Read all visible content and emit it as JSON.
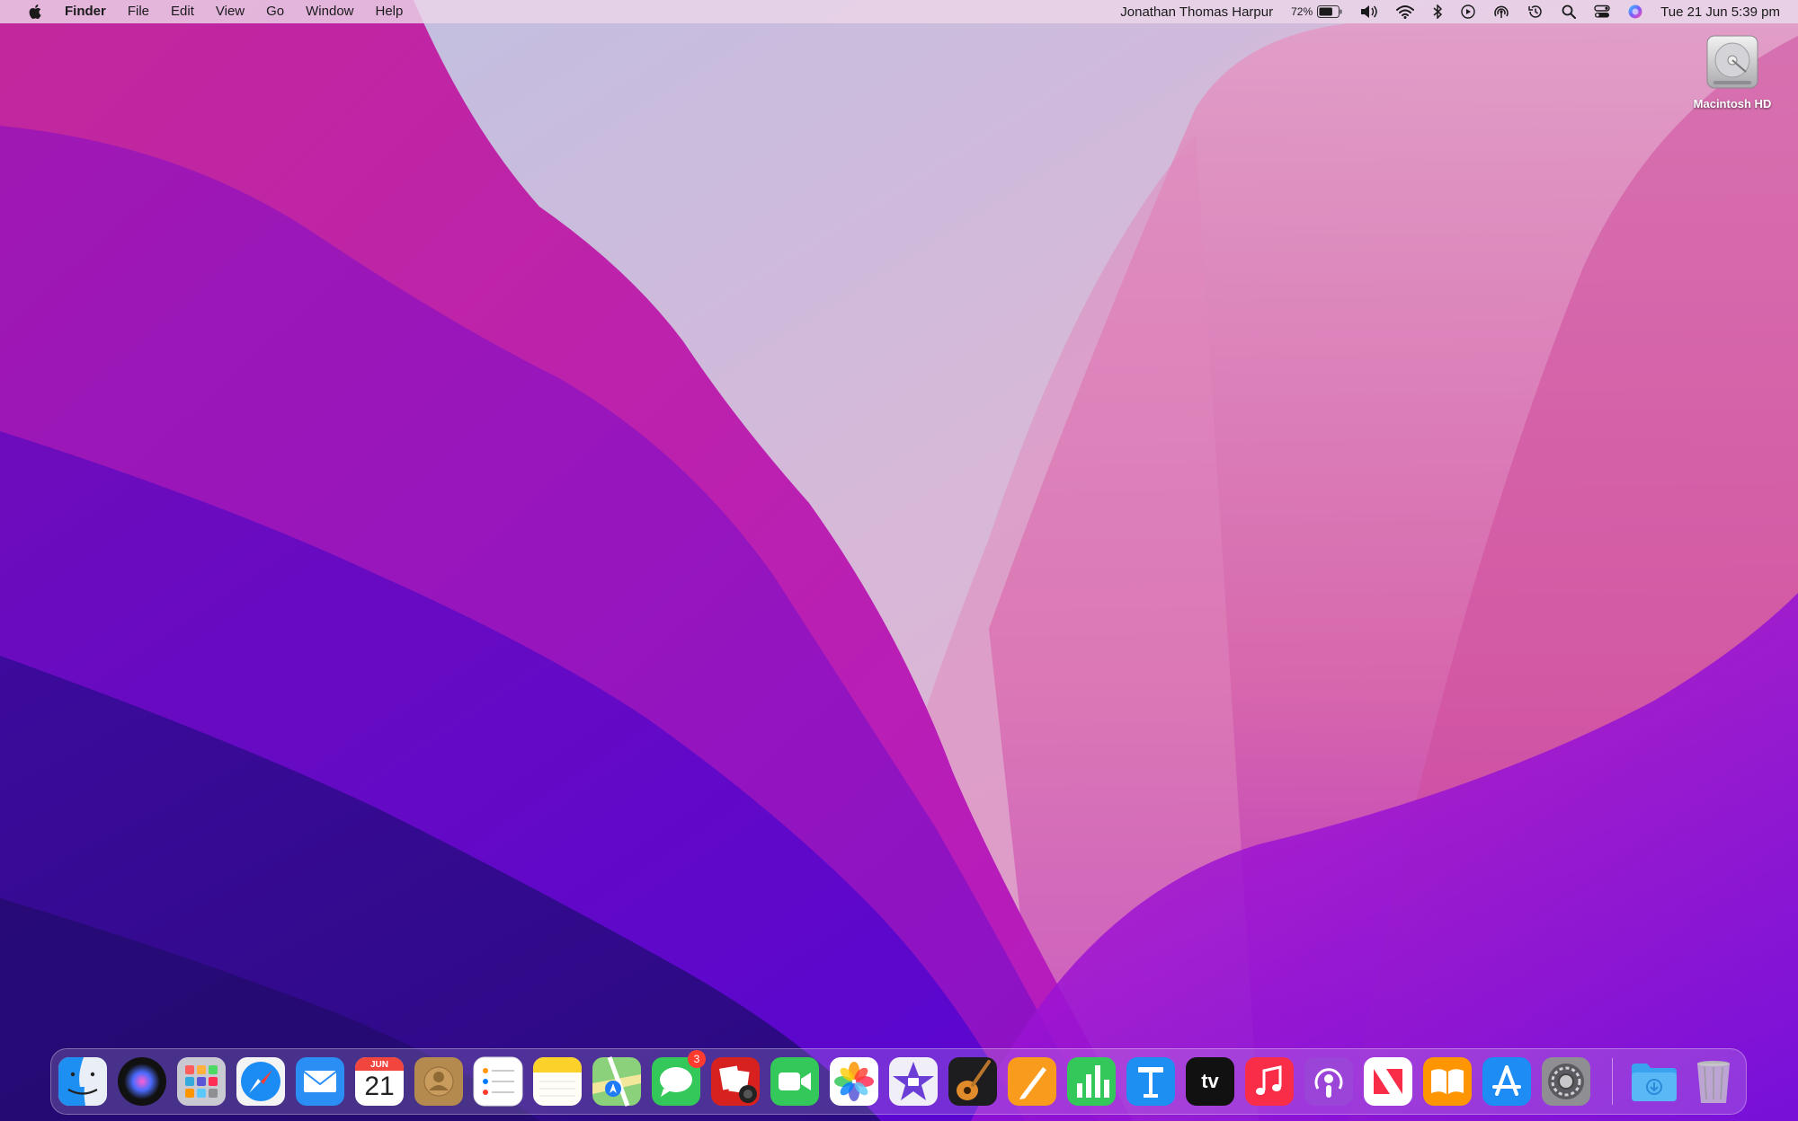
{
  "menubar": {
    "app_name": "Finder",
    "menus": [
      "File",
      "Edit",
      "View",
      "Go",
      "Window",
      "Help"
    ],
    "user_name": "Jonathan Thomas Harpur",
    "battery_percent": "72%",
    "battery_level": 0.72,
    "datetime": "Tue 21 Jun  5:39 pm",
    "status_icons": [
      "battery-icon",
      "volume-icon",
      "wifi-icon",
      "bluetooth-icon",
      "now-playing-icon",
      "airdrop-icon",
      "time-machine-icon",
      "spotlight-icon",
      "control-center-icon",
      "siri-icon"
    ]
  },
  "desktop": {
    "icons": [
      {
        "label": "Macintosh HD",
        "icon": "hard-drive-icon"
      }
    ]
  },
  "dock": {
    "calendar": {
      "month": "JUN",
      "day": "21"
    },
    "messages_badge": "3",
    "tv_label": "tv",
    "apps": [
      "finder",
      "siri",
      "launchpad",
      "safari",
      "mail",
      "calendar",
      "contacts",
      "reminders",
      "notes",
      "maps",
      "messages",
      "photo-booth",
      "facetime",
      "photos",
      "imovie",
      "garageband",
      "pages",
      "numbers",
      "keynote",
      "apple-tv",
      "music",
      "podcasts",
      "news",
      "books",
      "app-store",
      "system-preferences",
      "downloads",
      "trash"
    ]
  },
  "colors": {
    "menubar_bg": "#ecd6e9",
    "badge": "#ff3b30",
    "wallpaper_top_left": "#c82fa0",
    "wallpaper_bottom": "#3b0aa6"
  }
}
